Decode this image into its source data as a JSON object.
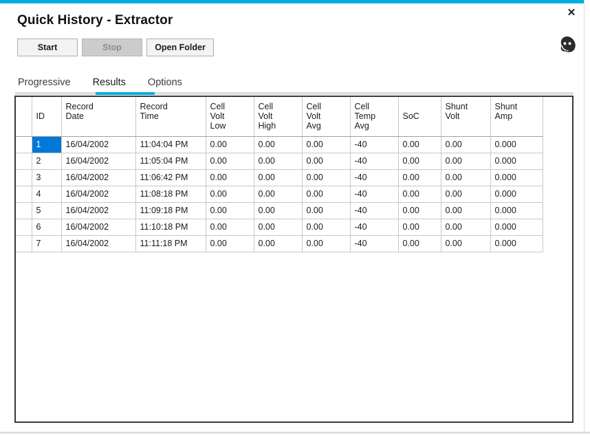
{
  "window": {
    "accent_color": "#00AEE0",
    "close_label": "✕",
    "close_icon": "close-icon",
    "support_icon": "headset-support-icon"
  },
  "header": {
    "title": "Quick History - Extractor"
  },
  "toolbar": {
    "start_label": "Start",
    "stop_label": "Stop",
    "open_folder_label": "Open Folder"
  },
  "tabs": {
    "items": [
      {
        "label": "Progressive",
        "active": false
      },
      {
        "label": "Results",
        "active": true
      },
      {
        "label": "Options",
        "active": false
      }
    ],
    "active_index": 1,
    "active_underline_color": "#00AEE0"
  },
  "grid": {
    "selection_color": "#0078D7",
    "columns": [
      {
        "key": "id",
        "header": "ID"
      },
      {
        "key": "date",
        "header": "Record\nDate"
      },
      {
        "key": "time",
        "header": "Record\nTime"
      },
      {
        "key": "cvl",
        "header": "Cell\nVolt\nLow"
      },
      {
        "key": "cvh",
        "header": "Cell\nVolt\nHigh"
      },
      {
        "key": "cva",
        "header": "Cell\nVolt\nAvg"
      },
      {
        "key": "cta",
        "header": "Cell\nTemp\nAvg"
      },
      {
        "key": "soc",
        "header": "SoC"
      },
      {
        "key": "sv",
        "header": "Shunt\nVolt"
      },
      {
        "key": "sa",
        "header": "Shunt\nAmp"
      }
    ],
    "rows": [
      {
        "id": "1",
        "date": "16/04/2002",
        "time": "11:04:04 PM",
        "cvl": "0.00",
        "cvh": "0.00",
        "cva": "0.00",
        "cta": "-40",
        "soc": "0.00",
        "sv": "0.00",
        "sa": "0.000",
        "selected": true
      },
      {
        "id": "2",
        "date": "16/04/2002",
        "time": "11:05:04 PM",
        "cvl": "0.00",
        "cvh": "0.00",
        "cva": "0.00",
        "cta": "-40",
        "soc": "0.00",
        "sv": "0.00",
        "sa": "0.000",
        "selected": false
      },
      {
        "id": "3",
        "date": "16/04/2002",
        "time": "11:06:42 PM",
        "cvl": "0.00",
        "cvh": "0.00",
        "cva": "0.00",
        "cta": "-40",
        "soc": "0.00",
        "sv": "0.00",
        "sa": "0.000",
        "selected": false
      },
      {
        "id": "4",
        "date": "16/04/2002",
        "time": "11:08:18 PM",
        "cvl": "0.00",
        "cvh": "0.00",
        "cva": "0.00",
        "cta": "-40",
        "soc": "0.00",
        "sv": "0.00",
        "sa": "0.000",
        "selected": false
      },
      {
        "id": "5",
        "date": "16/04/2002",
        "time": "11:09:18 PM",
        "cvl": "0.00",
        "cvh": "0.00",
        "cva": "0.00",
        "cta": "-40",
        "soc": "0.00",
        "sv": "0.00",
        "sa": "0.000",
        "selected": false
      },
      {
        "id": "6",
        "date": "16/04/2002",
        "time": "11:10:18 PM",
        "cvl": "0.00",
        "cvh": "0.00",
        "cva": "0.00",
        "cta": "-40",
        "soc": "0.00",
        "sv": "0.00",
        "sa": "0.000",
        "selected": false
      },
      {
        "id": "7",
        "date": "16/04/2002",
        "time": "11:11:18 PM",
        "cvl": "0.00",
        "cvh": "0.00",
        "cva": "0.00",
        "cta": "-40",
        "soc": "0.00",
        "sv": "0.00",
        "sa": "0.000",
        "selected": false
      }
    ]
  }
}
